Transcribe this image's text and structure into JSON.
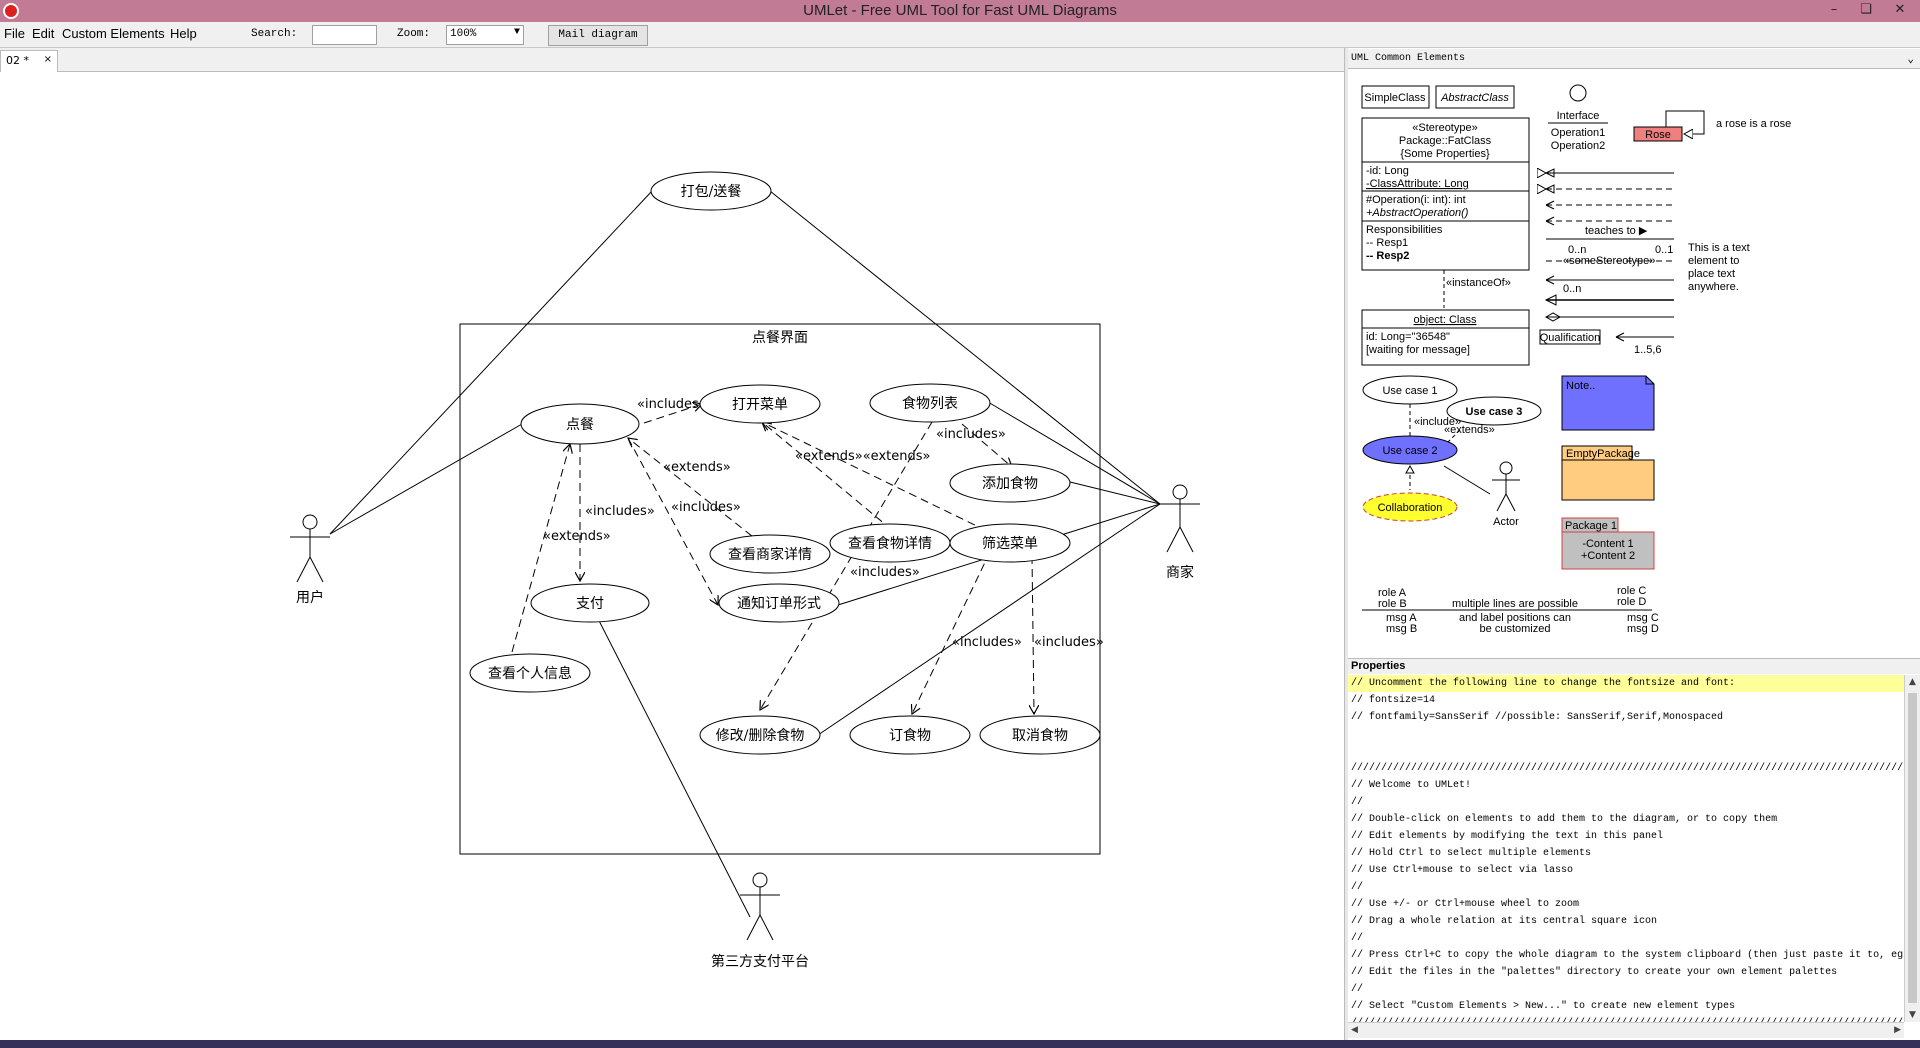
{
  "window": {
    "title": "UMLet - Free UML Tool for Fast UML Diagrams",
    "minimize": "–",
    "maximize": "❏",
    "close": "✕"
  },
  "menu": {
    "file": "File",
    "edit": "Edit",
    "custom": "Custom Elements",
    "help": "Help"
  },
  "toolbar": {
    "search_label": "Search:",
    "search_value": "",
    "zoom_label": "Zoom:",
    "zoom_value": "100%",
    "mail_button": "Mail diagram"
  },
  "tab": {
    "label": "02 *",
    "close": "×"
  },
  "diagram": {
    "system_title": "点餐界面",
    "actors": {
      "user": "用户",
      "merchant": "商家",
      "payment": "第三方支付平台"
    },
    "use_cases": {
      "pack_delivery": "打包/送餐",
      "order": "点餐",
      "open_menu": "打开菜单",
      "food_list": "食物列表",
      "add_food": "添加食物",
      "view_merchant": "查看商家详情",
      "view_food": "查看食物详情",
      "filter_menu": "筛选菜单",
      "pay": "支付",
      "notify_form": "通知订单形式",
      "view_personal": "查看个人信息",
      "edit_food": "修改/删除食物",
      "order_food": "订食物",
      "cancel_food": "取消食物"
    },
    "relations": {
      "includes": "«includes»",
      "extends": "«extends»",
      "extends_extends": "«extends»«extends»"
    }
  },
  "palette": {
    "header": "UML Common Elements",
    "dropdown_icon": "chevron-down-icon",
    "simple_class": "SimpleClass",
    "abstract_class": "AbstractClass",
    "interface": "Interface",
    "operation1": "Operation1",
    "operation2": "Operation2",
    "rose": "Rose",
    "rose_text": "a rose is a rose",
    "fat_stereo": "«Stereotype»",
    "fat_name": "Package::FatClass",
    "fat_props": "{Some Properties}",
    "fat_attr1": "-id: Long",
    "fat_attr2": "-ClassAttribute: Long",
    "fat_op1": "#Operation(i: int): int",
    "fat_op2": "+AbstractOperation()",
    "fat_resp": "Responsibilities",
    "fat_resp1": "-- Resp1",
    "fat_resp2": "-- Resp2",
    "teaches": "teaches to ▶",
    "mult_left": "0..n",
    "mult_right": "0..1",
    "some_stereo": "«someStereotype»",
    "mult_left2": "0..n",
    "text_element_1": "This is a text",
    "text_element_2": "element to",
    "text_element_3": "place text",
    "text_element_4": "anywhere.",
    "instance_of": "«instanceOf»",
    "object_name": "object: Class",
    "object_attr1": "id: Long=\"36548\"",
    "object_attr2": "[waiting for message]",
    "qualification": "Qualification",
    "qual_mult": "1..5,6",
    "use_case_1": "Use case 1",
    "use_case_2": "Use case 2",
    "use_case_3": "Use case 3",
    "uc_include": "«include»",
    "uc_extends": "«extends»",
    "note": "Note..",
    "empty_package": "EmptyPackage",
    "package1": "Package 1",
    "content1": "-Content 1",
    "content2": "+Content 2",
    "collaboration": "Collaboration",
    "actor": "Actor",
    "role_a": "role A",
    "role_b": "role B",
    "role_c": "role C",
    "role_d": "role D",
    "multi_line_1": "multiple lines are possible",
    "multi_line_2": "and label positions can",
    "multi_line_3": "be customized",
    "msg_a": "msg A",
    "msg_b": "msg B",
    "msg_c": "msg C",
    "msg_d": "msg D"
  },
  "properties": {
    "header": "Properties",
    "lines": [
      "// Uncomment the following line to change the fontsize and font:",
      "// fontsize=14",
      "// fontfamily=SansSerif //possible: SansSerif,Serif,Monospaced",
      "",
      "",
      "//////////////////////////////////////////////////////////////////////////////////////////////",
      "// Welcome to UMLet!",
      "//",
      "// Double-click on elements to add them to the diagram, or to copy them",
      "// Edit elements by modifying the text in this panel",
      "// Hold Ctrl to select multiple elements",
      "// Use Ctrl+mouse to select via lasso",
      "//",
      "// Use +/- or Ctrl+mouse wheel to zoom",
      "// Drag a whole relation at its central square icon",
      "//",
      "// Press Ctrl+C to copy the whole diagram to the system clipboard (then just paste it to, eg,",
      "// Edit the files in the \"palettes\" directory to create your own element palettes",
      "//",
      "// Select \"Custom Elements > New...\" to create new element types",
      "//////////////////////////////////////////////////////////////////////////////////////////////"
    ]
  }
}
